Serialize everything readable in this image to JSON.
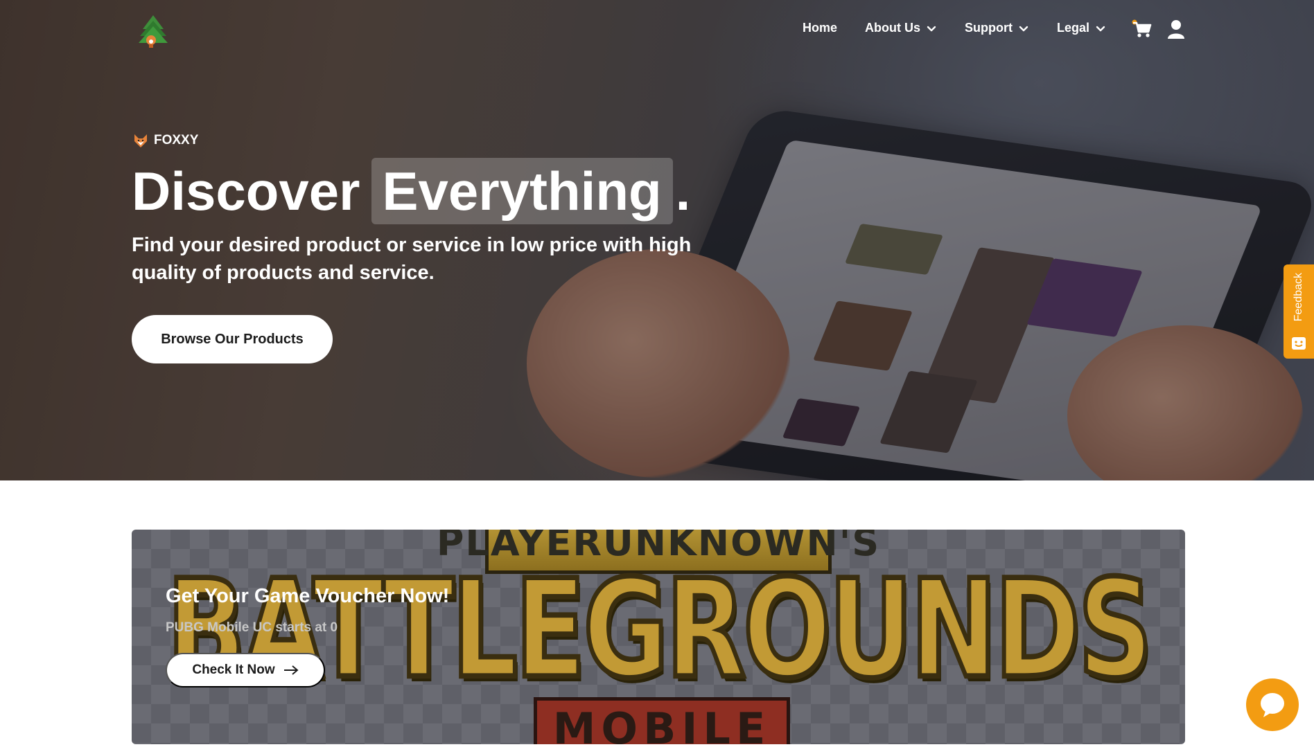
{
  "nav": {
    "items": [
      {
        "label": "Home",
        "has_dropdown": false
      },
      {
        "label": "About Us",
        "has_dropdown": true
      },
      {
        "label": "Support",
        "has_dropdown": true
      },
      {
        "label": "Legal",
        "has_dropdown": true
      }
    ],
    "icons": [
      "cart-icon",
      "user-icon"
    ]
  },
  "hero": {
    "brand": "FOXXY",
    "headline_part1": "Discover",
    "headline_highlight": "Everything",
    "headline_end": ".",
    "subtitle": "Find your desired product or service in low price with high quality of products and service.",
    "cta_label": "Browse Our Products"
  },
  "feedback": {
    "label": "Feedback"
  },
  "banner": {
    "title": "Get Your Game Voucher Now!",
    "subtitle": "PUBG Mobile UC starts at 0",
    "cta_label": "Check It Now",
    "logo_top": "PLAYERUNKNOWN'S",
    "logo_main": "BATTLEGROUNDS",
    "logo_bottom": "MOBILE"
  },
  "colors": {
    "accent": "#f39c12",
    "hero_overlay": "#1a1a1e",
    "text": "#ffffff"
  }
}
